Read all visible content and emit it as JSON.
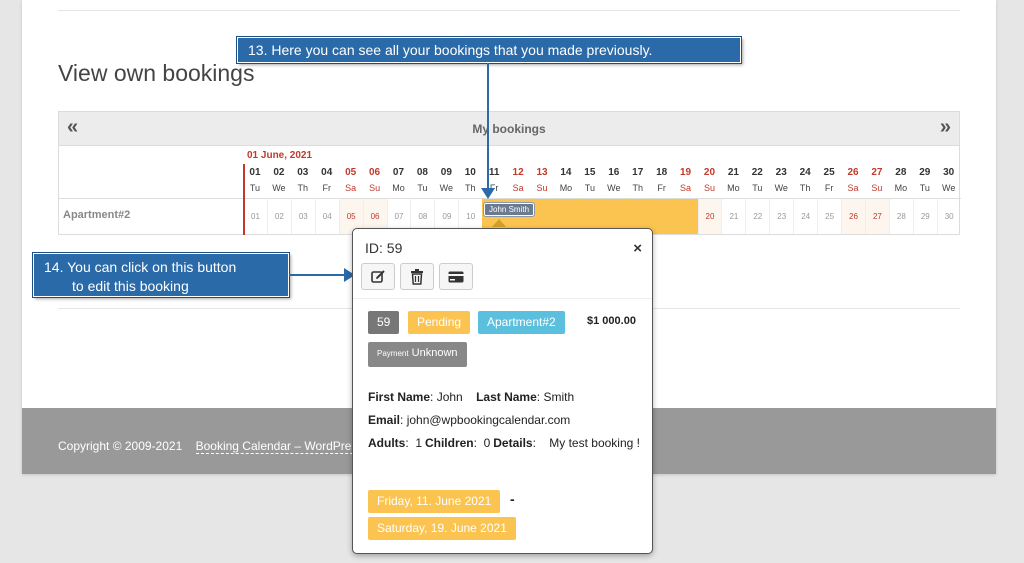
{
  "page": {
    "title": "View own bookings"
  },
  "calendar": {
    "prev": "«",
    "next": "»",
    "title": "My bookings",
    "month_label": "01 June, 2021",
    "resource": "Apartment#2",
    "days": [
      {
        "n": "01",
        "d": "Tu",
        "we": false
      },
      {
        "n": "02",
        "d": "We",
        "we": false
      },
      {
        "n": "03",
        "d": "Th",
        "we": false
      },
      {
        "n": "04",
        "d": "Fr",
        "we": false
      },
      {
        "n": "05",
        "d": "Sa",
        "we": true
      },
      {
        "n": "06",
        "d": "Su",
        "we": true
      },
      {
        "n": "07",
        "d": "Mo",
        "we": false
      },
      {
        "n": "08",
        "d": "Tu",
        "we": false
      },
      {
        "n": "09",
        "d": "We",
        "we": false
      },
      {
        "n": "10",
        "d": "Th",
        "we": false
      },
      {
        "n": "11",
        "d": "Fr",
        "we": false
      },
      {
        "n": "12",
        "d": "Sa",
        "we": true
      },
      {
        "n": "13",
        "d": "Su",
        "we": true
      },
      {
        "n": "14",
        "d": "Mo",
        "we": false
      },
      {
        "n": "15",
        "d": "Tu",
        "we": false
      },
      {
        "n": "16",
        "d": "We",
        "we": false
      },
      {
        "n": "17",
        "d": "Th",
        "we": false
      },
      {
        "n": "18",
        "d": "Fr",
        "we": false
      },
      {
        "n": "19",
        "d": "Sa",
        "we": true
      },
      {
        "n": "20",
        "d": "Su",
        "we": true
      },
      {
        "n": "21",
        "d": "Mo",
        "we": false
      },
      {
        "n": "22",
        "d": "Tu",
        "we": false
      },
      {
        "n": "23",
        "d": "We",
        "we": false
      },
      {
        "n": "24",
        "d": "Th",
        "we": false
      },
      {
        "n": "25",
        "d": "Fr",
        "we": false
      },
      {
        "n": "26",
        "d": "Sa",
        "we": true
      },
      {
        "n": "27",
        "d": "Su",
        "we": true
      },
      {
        "n": "28",
        "d": "Mo",
        "we": false
      },
      {
        "n": "29",
        "d": "Tu",
        "we": false
      },
      {
        "n": "30",
        "d": "We",
        "we": false
      }
    ],
    "booked_dates": [
      "11",
      "12",
      "13",
      "14",
      "15",
      "16",
      "17",
      "18",
      "19"
    ],
    "booking_chip": "John Smith"
  },
  "callouts": {
    "c13": "13. Here you can  see all  your bookings that  you made previously.",
    "c14_line1": "14. You can  click on this button",
    "c14_line2": "to  edit this booking"
  },
  "popup": {
    "id_label": "ID: 59",
    "close": "×",
    "badge_id": "59",
    "status": "Pending",
    "resource": "Apartment#2",
    "cost": "$1 000.00",
    "payment_prefix": "Payment",
    "payment_status": "Unknown",
    "first_name_label": "First Name",
    "first_name": "John",
    "last_name_label": "Last Name",
    "last_name": "Smith",
    "email_label": "Email",
    "email": "john@wpbookingcalendar.com",
    "adults_label": "Adults",
    "adults": "1",
    "children_label": "Children",
    "children": "0",
    "details_label": "Details",
    "details": "My test booking !",
    "date_from": "Friday, 11. June 2021",
    "date_to": "Saturday, 19. June 2021",
    "dash": "-"
  },
  "footer": {
    "copyright": "Copyright © 2009-2021",
    "link": "Booking Calendar – WordPress"
  },
  "colors": {
    "accent_blue": "#2a6aa8",
    "pending": "#fbc350",
    "resource": "#5bc0de",
    "weekend": "#c0392b"
  }
}
